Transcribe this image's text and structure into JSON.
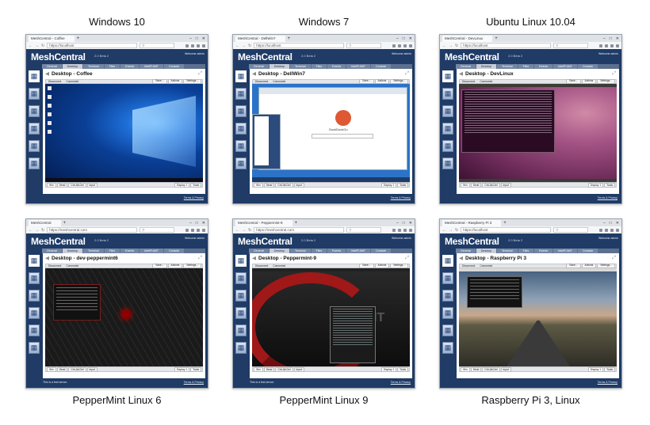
{
  "app": {
    "logo": "MeshCentral",
    "beta": "2.0 Beta 2",
    "welcome": "Welcome admin",
    "terms": "Terms & Privacy",
    "test_server": "This is a test server.",
    "tabs": [
      "General",
      "Desktop",
      "Terminal",
      "Files",
      "Events",
      "Intel® AMT",
      "Console"
    ],
    "toolbar": {
      "disconnect": "Disconnect",
      "status": "Connected",
      "save": "Save...",
      "actions": "Actions",
      "settings": "Settings..."
    },
    "bottom": {
      "win": "Win",
      "send": "Send",
      "ctrl_alt_del": "Ctrl-Alt-Del",
      "input": "Input",
      "tools": "Tools",
      "display": "Display 1"
    }
  },
  "panels": [
    {
      "caption": "Windows 10",
      "tab_title": "MeshCentral - Coffee",
      "url": "https://localhost",
      "desktop_title": "Desktop - Coffee"
    },
    {
      "caption": "Windows 7",
      "tab_title": "MeshCentral - DellWin7",
      "url": "https://localhost",
      "desktop_title": "Desktop - DellWin7",
      "duck": "DuckDuckGo"
    },
    {
      "caption": "Ubuntu Linux 10.04",
      "tab_title": "MeshCentral - DevLinux",
      "url": "https://localhost",
      "desktop_title": "Desktop - DevLinux"
    },
    {
      "caption": "PepperMint Linux 6",
      "tab_title": "MeshCentral",
      "url": "https://meshcentral.com",
      "desktop_title": "Desktop - dev-peppermint6"
    },
    {
      "caption": "PepperMint Linux 9",
      "tab_title": "MeshCentral - Peppermint-9",
      "url": "https://meshcentral.com",
      "desktop_title": "Desktop - Peppermint-9",
      "nt": "NT"
    },
    {
      "caption": "Raspberry Pi 3, Linux",
      "tab_title": "MeshCentral - Raspberry Pi 3",
      "url": "https://localhost",
      "desktop_title": "Desktop - Raspberry Pi 3"
    }
  ]
}
